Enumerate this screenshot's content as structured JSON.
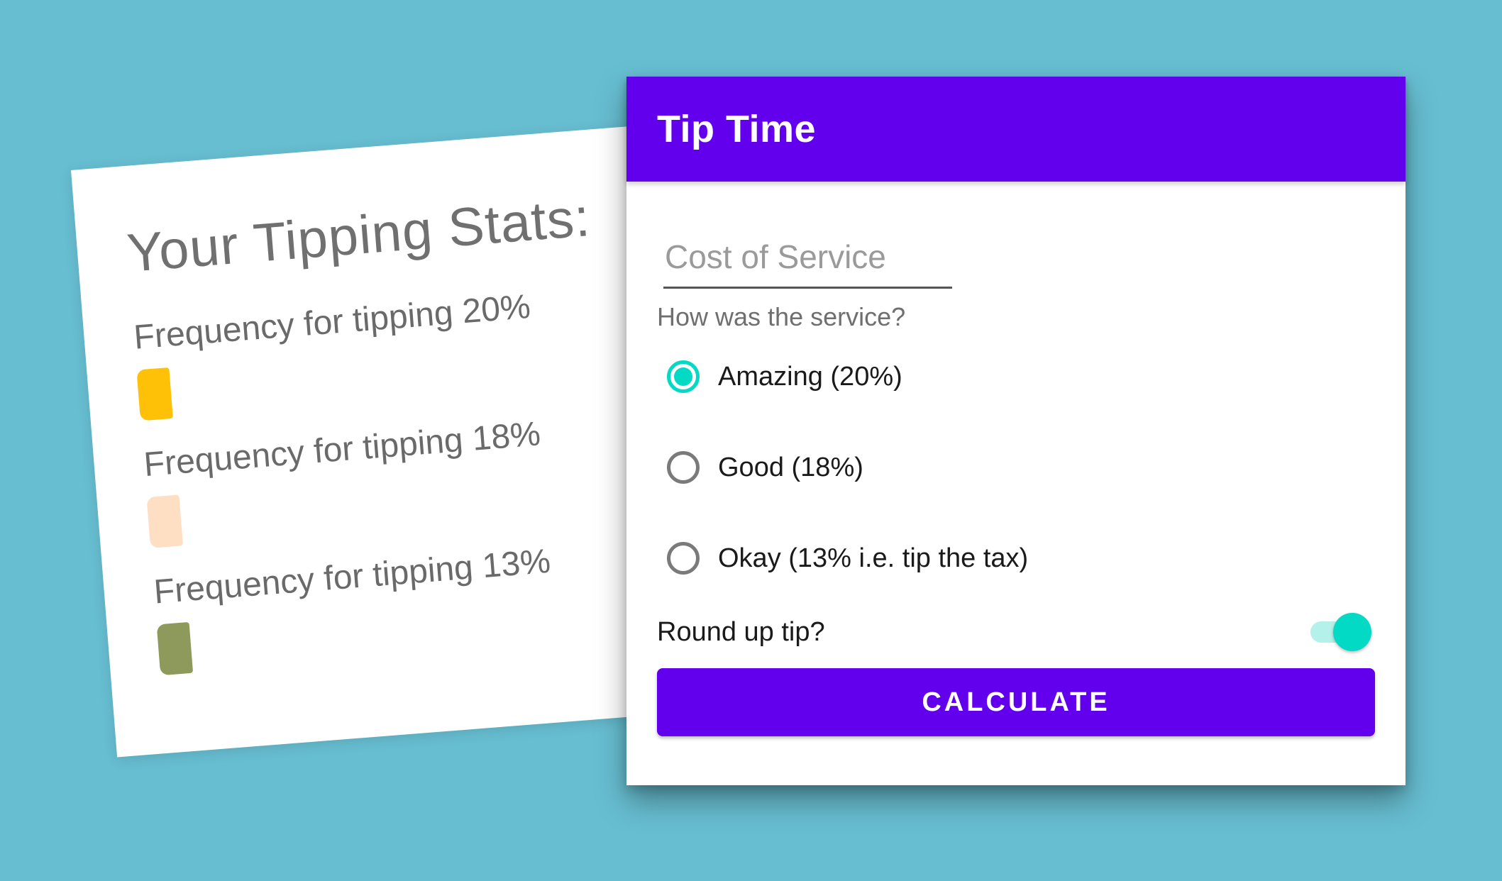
{
  "stats": {
    "title": "Your Tipping Stats:",
    "rows": [
      {
        "label": "Frequency for tipping 20%",
        "color": "#ffc107"
      },
      {
        "label": "Frequency for tipping 18%",
        "color": "#ffdfc4"
      },
      {
        "label": "Frequency for tipping 13%",
        "color": "#8d9a5c"
      }
    ]
  },
  "app": {
    "title": "Tip Time",
    "cost_placeholder": "Cost of Service",
    "question": "How was the service?",
    "options": [
      {
        "label": "Amazing (20%)",
        "selected": true
      },
      {
        "label": "Good (18%)",
        "selected": false
      },
      {
        "label": "Okay (13% i.e. tip the tax)",
        "selected": false
      }
    ],
    "round_up_label": "Round up tip?",
    "round_up_on": true,
    "calculate_label": "CALCULATE",
    "colors": {
      "primary": "#6200ee",
      "secondary": "#03dac5",
      "background": "#67bed1"
    }
  }
}
